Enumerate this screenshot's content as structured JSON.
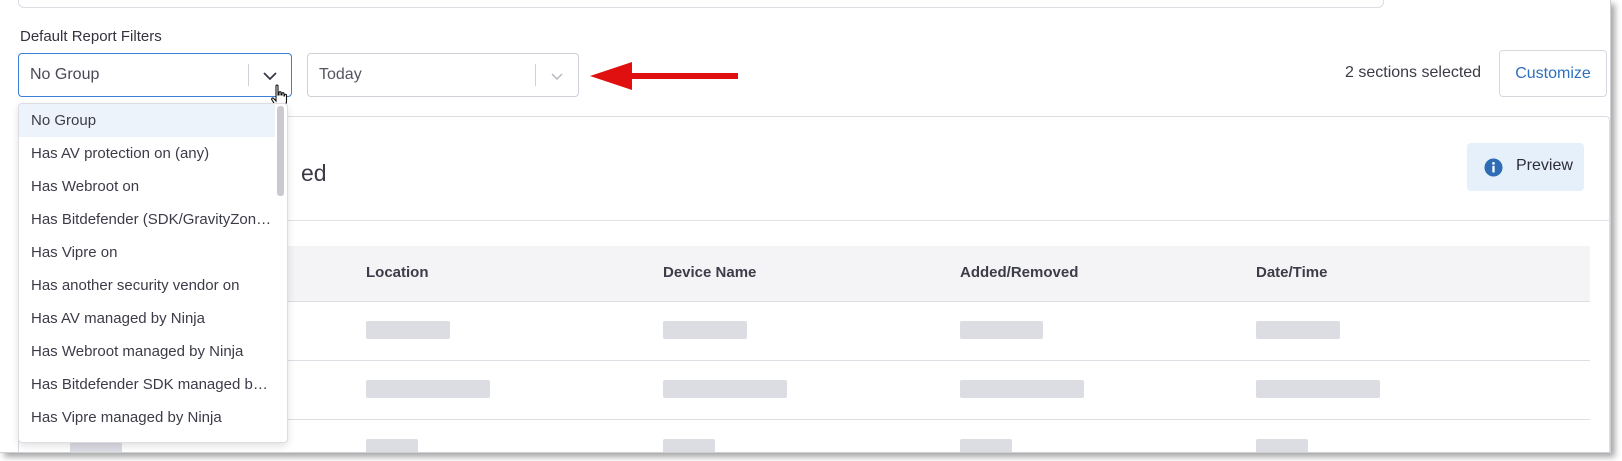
{
  "filters": {
    "label": "Default Report Filters",
    "group_select": {
      "value": "No Group"
    },
    "date_select": {
      "value": "Today"
    },
    "sections_selected": "2 sections selected",
    "customize_label": "Customize"
  },
  "dropdown": {
    "options": [
      "No Group",
      "Has AV protection on (any)",
      "Has Webroot on",
      "Has Bitdefender (SDK/GravityZone) on",
      "Has Vipre on",
      "Has another security vendor on",
      "Has AV managed by Ninja",
      "Has Webroot managed by Ninja",
      "Has Bitdefender SDK managed by Ninja",
      "Has Vipre managed by Ninja"
    ],
    "selected_index": 0
  },
  "card": {
    "title_visible_tail": "ed",
    "preview_label": "Preview"
  },
  "table": {
    "columns": [
      "Location",
      "Device Name",
      "Added/Removed",
      "Date/Time"
    ]
  },
  "colors": {
    "accent": "#3c7fd4",
    "link": "#2f6fbf",
    "annotation_arrow": "#e01010"
  }
}
